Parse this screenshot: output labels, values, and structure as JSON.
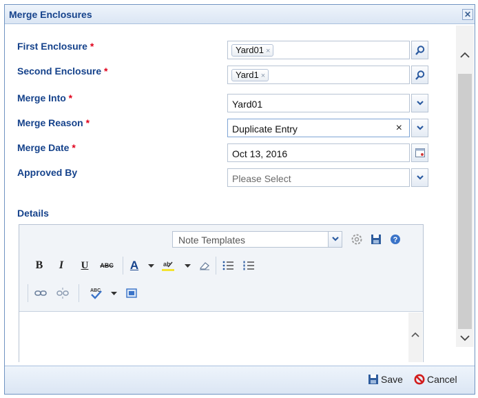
{
  "dialog": {
    "title": "Merge Enclosures",
    "close_symbol": "✕"
  },
  "form": {
    "first_enclosure": {
      "label": "First Enclosure",
      "required_mark": "*",
      "token": "Yard01",
      "token_remove": "×"
    },
    "second_enclosure": {
      "label": "Second Enclosure",
      "required_mark": "*",
      "token": "Yard1",
      "token_remove": "×"
    },
    "merge_into": {
      "label": "Merge Into",
      "required_mark": "*",
      "value": "Yard01"
    },
    "merge_reason": {
      "label": "Merge Reason",
      "required_mark": "*",
      "value": "Duplicate Entry",
      "clear_symbol": "×"
    },
    "merge_date": {
      "label": "Merge Date",
      "required_mark": "*",
      "value": "Oct 13, 2016"
    },
    "approved_by": {
      "label": "Approved By",
      "placeholder": "Please Select"
    },
    "details": {
      "label": "Details"
    }
  },
  "editor": {
    "note_templates_placeholder": "Note Templates",
    "bold": "B",
    "italic": "I",
    "underline": "U",
    "strikethrough": "ABC",
    "font_color": "A"
  },
  "footer": {
    "save_label": "Save",
    "cancel_label": "Cancel"
  },
  "icons": [
    "search-icon",
    "chevron-down-icon",
    "calendar-icon",
    "settings-icon",
    "save-icon",
    "help-icon",
    "link-icon",
    "unlink-icon",
    "spellcheck-icon",
    "image-icon",
    "eraser-icon",
    "bullet-list-icon",
    "numbered-list-icon",
    "highlight-icon",
    "cancel-icon"
  ],
  "colors": {
    "label": "#15428b",
    "required": "#e0001b",
    "border": "#6f93c1"
  }
}
